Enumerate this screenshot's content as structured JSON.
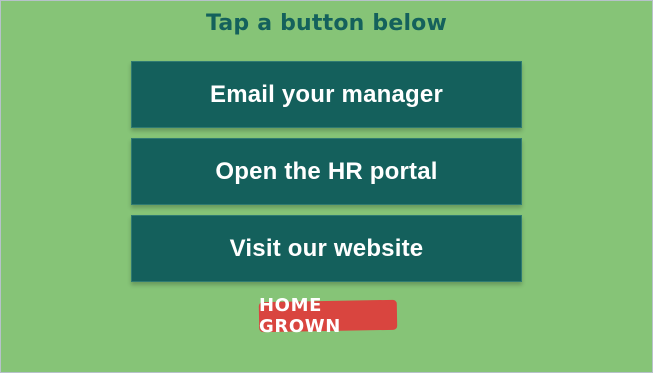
{
  "header": {
    "title": "Tap a button below"
  },
  "buttons": [
    {
      "label": "Email your manager"
    },
    {
      "label": "Open the HR portal"
    },
    {
      "label": "Visit our website"
    }
  ],
  "logo": {
    "text": "HOME GROWN",
    "colors": {
      "badge": "#d9453f",
      "text": "#ffffff"
    }
  },
  "colors": {
    "background": "#86c477",
    "title": "#14615c",
    "button": "#14605c",
    "button_text": "#ffffff"
  }
}
